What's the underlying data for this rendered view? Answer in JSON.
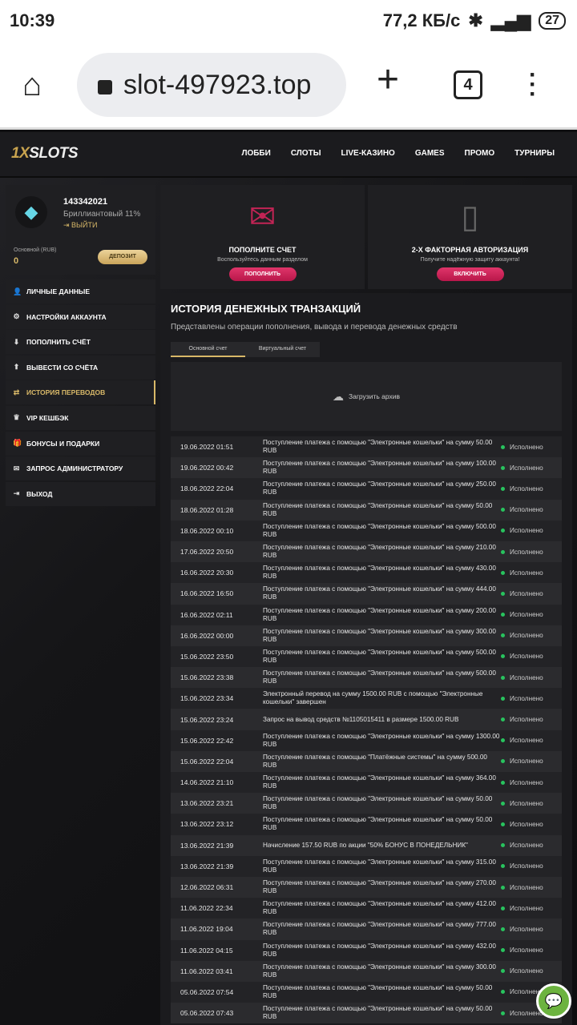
{
  "statusbar": {
    "time": "10:39",
    "speed": "77,2 КБ/с",
    "battery": "27"
  },
  "browser": {
    "url": "slot-497923.top",
    "tabs": "4"
  },
  "site": {
    "logo_a": "1X",
    "logo_b": "SLOTS",
    "nav": [
      "ЛОББИ",
      "СЛОТЫ",
      "LIVE-КАЗИНО",
      "GAMES",
      "ПРОМО",
      "ТУРНИРЫ"
    ]
  },
  "profile": {
    "id": "143342021",
    "level": "Бриллиантовый 11%",
    "logout": "ВЫЙТИ",
    "balance_label": "Основной (RUB)",
    "balance": "0",
    "deposit": "ДЕПОЗИТ"
  },
  "sidebar": [
    {
      "label": "ЛИЧНЫЕ ДАННЫЕ",
      "icon": "👤",
      "name": "user-icon"
    },
    {
      "label": "НАСТРОЙКИ АККАУНТА",
      "icon": "⚙",
      "name": "gear-icon"
    },
    {
      "label": "ПОПОЛНИТЬ СЧЁТ",
      "icon": "⬇",
      "name": "download-icon"
    },
    {
      "label": "ВЫВЕСТИ СО СЧЁТА",
      "icon": "⬆",
      "name": "upload-icon"
    },
    {
      "label": "ИСТОРИЯ ПЕРЕВОДОВ",
      "icon": "⇄",
      "name": "transfer-icon",
      "active": true
    },
    {
      "label": "VIP КЕШБЭК",
      "icon": "♛",
      "name": "crown-icon"
    },
    {
      "label": "БОНУСЫ И ПОДАРКИ",
      "icon": "🎁",
      "name": "gift-icon"
    },
    {
      "label": "ЗАПРОС АДМИНИСТРАТОРУ",
      "icon": "✉",
      "name": "mail-icon"
    },
    {
      "label": "ВЫХОД",
      "icon": "⇥",
      "name": "logout-icon"
    }
  ],
  "cards": [
    {
      "title": "ПОПОЛНИТЕ СЧЕТ",
      "text": "Воспользуйтесь данным разделом",
      "button": "ПОПОЛНИТЬ"
    },
    {
      "title": "2-Х ФАКТОРНАЯ АВТОРИЗАЦИЯ",
      "text": "Получите надёжную защиту аккаунта!",
      "button": "ВКЛЮЧИТЬ"
    }
  ],
  "history": {
    "title": "ИСТОРИЯ ДЕНЕЖНЫХ ТРАНЗАКЦИЙ",
    "subtitle": "Представлены операции пополнения, вывода и перевода денежных средств",
    "tabs": [
      "Основной счет",
      "Виртуальный счет"
    ],
    "archive": "Загрузить архив",
    "rows": [
      [
        "19.06.2022 01:51",
        "Поступление платежа с помощью \"Электронные кошельки\" на сумму 50.00 RUB",
        "Исполнено"
      ],
      [
        "19.06.2022 00:42",
        "Поступление платежа с помощью \"Электронные кошельки\" на сумму 100.00 RUB",
        "Исполнено"
      ],
      [
        "18.06.2022 22:04",
        "Поступление платежа с помощью \"Электронные кошельки\" на сумму 250.00 RUB",
        "Исполнено"
      ],
      [
        "18.06.2022 01:28",
        "Поступление платежа с помощью \"Электронные кошельки\" на сумму 50.00 RUB",
        "Исполнено"
      ],
      [
        "18.06.2022 00:10",
        "Поступление платежа с помощью \"Электронные кошельки\" на сумму 500.00 RUB",
        "Исполнено"
      ],
      [
        "17.06.2022 20:50",
        "Поступление платежа с помощью \"Электронные кошельки\" на сумму 210.00 RUB",
        "Исполнено"
      ],
      [
        "16.06.2022 20:30",
        "Поступление платежа с помощью \"Электронные кошельки\" на сумму 430.00 RUB",
        "Исполнено"
      ],
      [
        "16.06.2022 16:50",
        "Поступление платежа с помощью \"Электронные кошельки\" на сумму 444.00 RUB",
        "Исполнено"
      ],
      [
        "16.06.2022 02:11",
        "Поступление платежа с помощью \"Электронные кошельки\" на сумму 200.00 RUB",
        "Исполнено"
      ],
      [
        "16.06.2022 00:00",
        "Поступление платежа с помощью \"Электронные кошельки\" на сумму 300.00 RUB",
        "Исполнено"
      ],
      [
        "15.06.2022 23:50",
        "Поступление платежа с помощью \"Электронные кошельки\" на сумму 500.00 RUB",
        "Исполнено"
      ],
      [
        "15.06.2022 23:38",
        "Поступление платежа с помощью \"Электронные кошельки\" на сумму 500.00 RUB",
        "Исполнено"
      ],
      [
        "15.06.2022 23:34",
        "Электронный перевод на сумму 1500.00 RUB с помощью \"Электронные кошельки\" завершен",
        "Исполнено"
      ],
      [
        "15.06.2022 23:24",
        "Запрос на вывод средств №1105015411 в размере 1500.00 RUB",
        "Исполнено"
      ],
      [
        "15.06.2022 22:42",
        "Поступление платежа с помощью \"Электронные кошельки\" на сумму 1300.00 RUB",
        "Исполнено"
      ],
      [
        "15.06.2022 22:04",
        "Поступление платежа с помощью \"Платёжные системы\" на сумму 500.00 RUB",
        "Исполнено"
      ],
      [
        "14.06.2022 21:10",
        "Поступление платежа с помощью \"Электронные кошельки\" на сумму 364.00 RUB",
        "Исполнено"
      ],
      [
        "13.06.2022 23:21",
        "Поступление платежа с помощью \"Электронные кошельки\" на сумму 50.00 RUB",
        "Исполнено"
      ],
      [
        "13.06.2022 23:12",
        "Поступление платежа с помощью \"Электронные кошельки\" на сумму 50.00 RUB",
        "Исполнено"
      ],
      [
        "13.06.2022 21:39",
        "Начисление 157.50 RUB по акции \"50% БОНУС В ПОНЕДЕЛЬНИК\"",
        "Исполнено"
      ],
      [
        "13.06.2022 21:39",
        "Поступление платежа с помощью \"Электронные кошельки\" на сумму 315.00 RUB",
        "Исполнено"
      ],
      [
        "12.06.2022 06:31",
        "Поступление платежа с помощью \"Электронные кошельки\" на сумму 270.00 RUB",
        "Исполнено"
      ],
      [
        "11.06.2022 22:34",
        "Поступление платежа с помощью \"Электронные кошельки\" на сумму 412.00 RUB",
        "Исполнено"
      ],
      [
        "11.06.2022 19:04",
        "Поступление платежа с помощью \"Электронные кошельки\" на сумму 777.00 RUB",
        "Исполнено"
      ],
      [
        "11.06.2022 04:15",
        "Поступление платежа с помощью \"Электронные кошельки\" на сумму 432.00 RUB",
        "Исполнено"
      ],
      [
        "11.06.2022 03:41",
        "Поступление платежа с помощью \"Электронные кошельки\" на сумму 300.00 RUB",
        "Исполнено"
      ],
      [
        "05.06.2022 07:54",
        "Поступление платежа с помощью \"Электронные кошельки\" на сумму 50.00 RUB",
        "Исполнено"
      ],
      [
        "05.06.2022 07:43",
        "Поступление платежа с помощью \"Электронные кошельки\" на сумму 50.00 RUB",
        "Исполнено"
      ]
    ]
  }
}
